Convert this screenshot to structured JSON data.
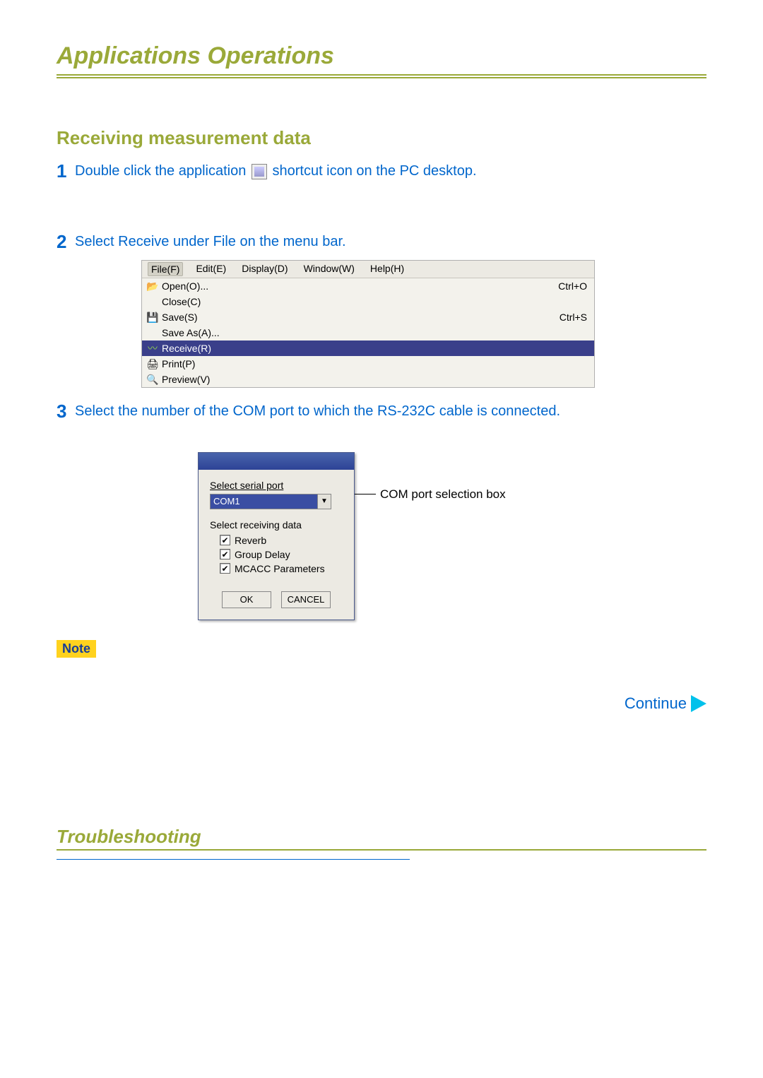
{
  "sectionTitle": "Applications Operations",
  "subtitle": "Receiving measurement data",
  "steps": {
    "s1": {
      "num": "1",
      "textBefore": "Double click the application ",
      "textAfter": "shortcut icon on the PC desktop."
    },
    "s2": {
      "num": "2",
      "text": "Select  Receive  under  File  on the menu bar."
    },
    "s3": {
      "num": "3",
      "text": "Select the number of the COM port to which the RS-232C cable is connected."
    }
  },
  "menubar": {
    "items": {
      "file": "File(F)",
      "edit": "Edit(E)",
      "display": "Display(D)",
      "window": "Window(W)",
      "help": "Help(H)"
    }
  },
  "fileMenu": [
    {
      "label": "Open(O)...",
      "shortcut": "Ctrl+O",
      "icon": "open"
    },
    {
      "label": "Close(C)",
      "shortcut": "",
      "icon": ""
    },
    {
      "label": "Save(S)",
      "shortcut": "Ctrl+S",
      "icon": "save"
    },
    {
      "label": "Save As(A)...",
      "shortcut": "",
      "icon": ""
    },
    {
      "label": "Receive(R)",
      "shortcut": "",
      "icon": "receive",
      "hl": true
    },
    {
      "label": "Print(P)",
      "shortcut": "",
      "icon": "print"
    },
    {
      "label": "Preview(V)",
      "shortcut": "",
      "icon": "preview"
    }
  ],
  "dialog": {
    "selectSerial": "Select serial port",
    "comValue": "COM1",
    "selectReceiving": "Select receiving data",
    "chk1": "Reverb",
    "chk2": "Group Delay",
    "chk3": "MCACC Parameters",
    "ok": "OK",
    "cancel": "CANCEL"
  },
  "callout": "COM port selection box",
  "note": "Note",
  "continue": "Continue",
  "troubleshooting": "Troubleshooting"
}
